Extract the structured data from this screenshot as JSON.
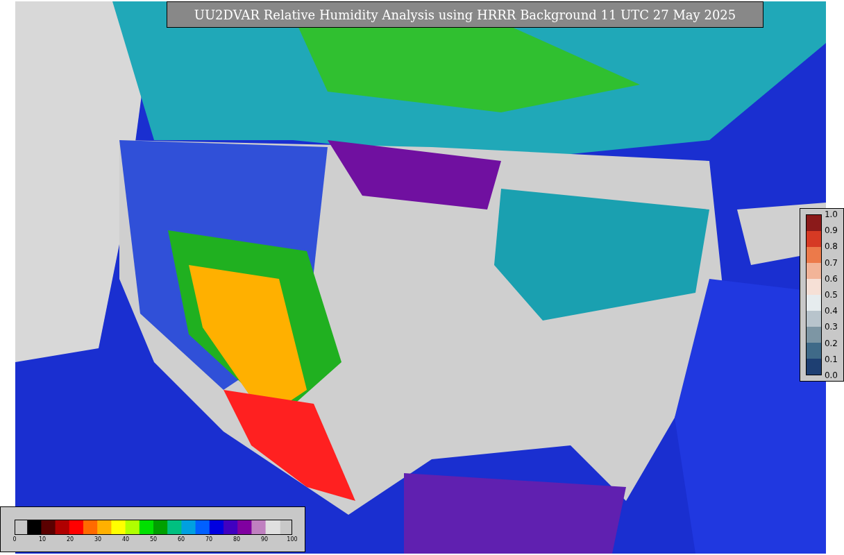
{
  "title": "UU2DVAR Relative Humidity Analysis using HRRR Background 11 UTC 27 May 2025",
  "obs_legend": {
    "labels": [
      "1.0",
      "0.9",
      "0.8",
      "0.7",
      "0.6",
      "0.5",
      "0.4",
      "0.3",
      "0.2",
      "0.1",
      "0.0"
    ],
    "swatches": [
      {
        "color": "#8b1a1a"
      },
      {
        "color": "#d63a24"
      },
      {
        "color": "#ec7a4a"
      },
      {
        "color": "#f2b498"
      },
      {
        "color": "#f6e0d6"
      },
      {
        "color": "#e6ecee"
      },
      {
        "color": "#b8c4cc"
      },
      {
        "color": "#7d96a4"
      },
      {
        "color": "#3f6a88"
      },
      {
        "color": "#1e3f72"
      }
    ]
  },
  "colorbar": {
    "ticks": [
      "0",
      "10",
      "20",
      "30",
      "40",
      "50",
      "60",
      "70",
      "80",
      "90",
      "100"
    ]
  }
}
